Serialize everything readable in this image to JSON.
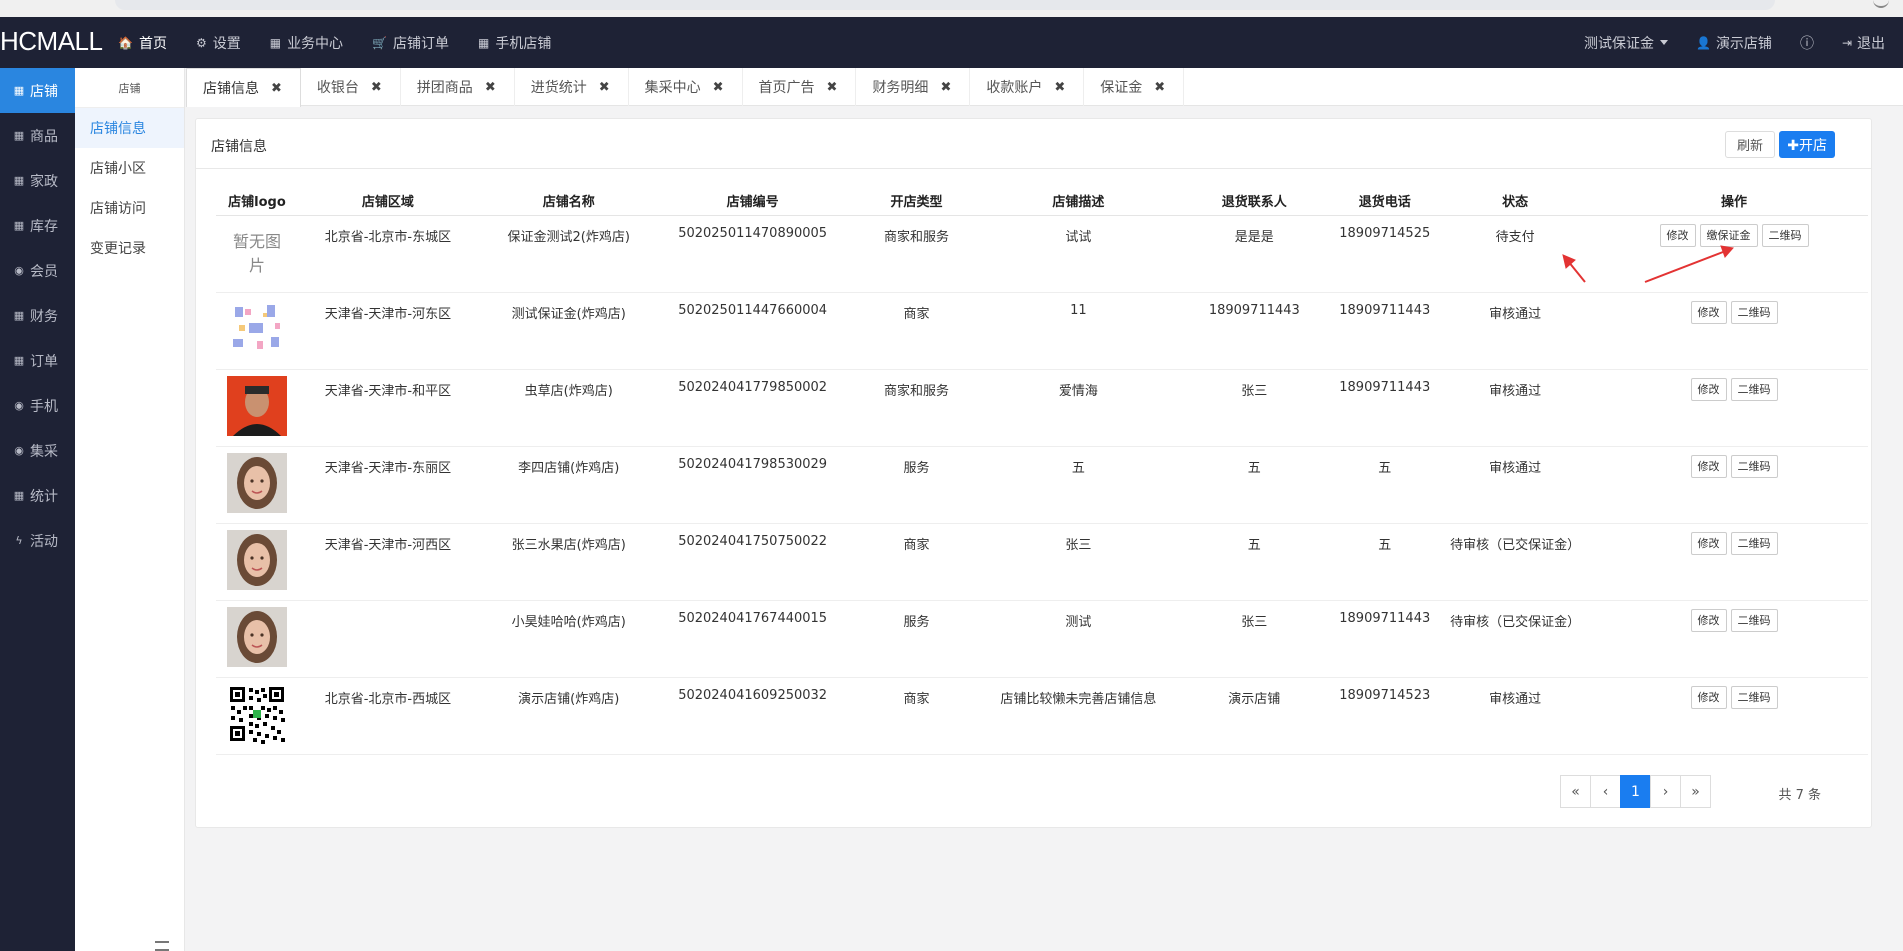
{
  "brand": "HCMALL",
  "topnav": [
    {
      "icon": "home-icon",
      "glyph": "🏠",
      "label": "首页",
      "active": true
    },
    {
      "icon": "gear-icon",
      "glyph": "⚙",
      "label": "设置"
    },
    {
      "icon": "calculator-icon",
      "glyph": "▦",
      "label": "业务中心"
    },
    {
      "icon": "cart-icon",
      "glyph": "🛒",
      "label": "店铺订单"
    },
    {
      "icon": "qrcode-icon",
      "glyph": "▦",
      "label": "手机店铺"
    }
  ],
  "topright": {
    "deposit_label": "测试保证金",
    "store_label": "演示店铺",
    "logout_label": "退出"
  },
  "leftbar": [
    {
      "label": "店铺",
      "icon": "grid-icon",
      "active": true
    },
    {
      "label": "商品",
      "icon": "grid-icon"
    },
    {
      "label": "家政",
      "icon": "grid-icon"
    },
    {
      "label": "库存",
      "icon": "grid-icon"
    },
    {
      "label": "会员",
      "icon": "globe-icon"
    },
    {
      "label": "财务",
      "icon": "grid-icon"
    },
    {
      "label": "订单",
      "icon": "grid-icon"
    },
    {
      "label": "手机",
      "icon": "globe-icon"
    },
    {
      "label": "集采",
      "icon": "globe-icon"
    },
    {
      "label": "统计",
      "icon": "grid-icon"
    },
    {
      "label": "活动",
      "icon": "bolt-icon"
    }
  ],
  "subnav": {
    "head": "店铺",
    "items": [
      {
        "label": "店铺信息",
        "active": true
      },
      {
        "label": "店铺小区"
      },
      {
        "label": "店铺访问"
      },
      {
        "label": "变更记录"
      }
    ]
  },
  "tabs": [
    {
      "label": "店铺信息",
      "active": true
    },
    {
      "label": "收银台"
    },
    {
      "label": "拼团商品"
    },
    {
      "label": "进货统计"
    },
    {
      "label": "集采中心"
    },
    {
      "label": "首页广告"
    },
    {
      "label": "财务明细"
    },
    {
      "label": "收款账户"
    },
    {
      "label": "保证金"
    }
  ],
  "card": {
    "title": "店铺信息",
    "refresh_label": "刷新",
    "open_label": "✚开店"
  },
  "table": {
    "headers": [
      "店铺logo",
      "店铺区域",
      "店铺名称",
      "店铺编号",
      "开店类型",
      "店铺描述",
      "退货联系人",
      "退货电话",
      "状态",
      "操作"
    ],
    "rows": [
      {
        "logo": "noimg",
        "logo_text": "暂无图片",
        "area": "北京省-北京市-东城区",
        "name": "保证金测试2(炸鸡店)",
        "code": "502025011470890005",
        "type": "商家和服务",
        "desc": "试试",
        "contact": "是是是",
        "phone": "18909714525",
        "status": "待支付",
        "ops": [
          "修改",
          "缴保证金",
          "二维码"
        ]
      },
      {
        "logo": "illustration",
        "area": "天津省-天津市-河东区",
        "name": "测试保证金(炸鸡店)",
        "code": "502025011447660004",
        "type": "商家",
        "desc": "11",
        "contact": "18909711443",
        "phone": "18909711443",
        "status": "审核通过",
        "ops": [
          "修改",
          "二维码"
        ]
      },
      {
        "logo": "portrait-red",
        "area": "天津省-天津市-和平区",
        "name": "虫草店(炸鸡店)",
        "code": "502024041779850002",
        "type": "商家和服务",
        "desc": "爱情海",
        "contact": "张三",
        "phone": "18909711443",
        "status": "审核通过",
        "ops": [
          "修改",
          "二维码"
        ]
      },
      {
        "logo": "portrait",
        "area": "天津省-天津市-东丽区",
        "name": "李四店铺(炸鸡店)",
        "code": "502024041798530029",
        "type": "服务",
        "desc": "五",
        "contact": "五",
        "phone": "五",
        "status": "审核通过",
        "ops": [
          "修改",
          "二维码"
        ]
      },
      {
        "logo": "portrait",
        "area": "天津省-天津市-河西区",
        "name": "张三水果店(炸鸡店)",
        "code": "502024041750750022",
        "type": "商家",
        "desc": "张三",
        "contact": "五",
        "phone": "五",
        "status": "待审核（已交保证金）",
        "ops": [
          "修改",
          "二维码"
        ]
      },
      {
        "logo": "portrait",
        "area": "",
        "name": "小昊娃哈哈(炸鸡店)",
        "code": "502024041767440015",
        "type": "服务",
        "desc": "测试",
        "contact": "张三",
        "phone": "18909711443",
        "status": "待审核（已交保证金）",
        "ops": [
          "修改",
          "二维码"
        ]
      },
      {
        "logo": "qrcode",
        "area": "北京省-北京市-西城区",
        "name": "演示店铺(炸鸡店)",
        "code": "502024041609250032",
        "type": "商家",
        "desc": "店铺比较懒未完善店铺信息",
        "contact": "演示店铺",
        "phone": "18909714523",
        "status": "审核通过",
        "ops": [
          "修改",
          "二维码"
        ]
      }
    ]
  },
  "pager": {
    "first": "«",
    "prev": "‹",
    "current": "1",
    "next": "›",
    "last": "»",
    "total": "共 7 条"
  },
  "colors": {
    "topbar": "#1e2235",
    "accent": "#1a7df0",
    "arrow": "#e33333"
  }
}
